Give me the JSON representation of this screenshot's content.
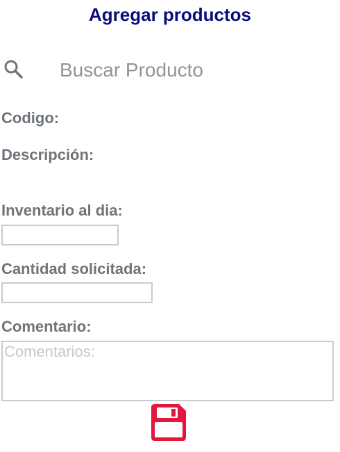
{
  "header": {
    "title": "Agregar productos"
  },
  "search": {
    "placeholder": "Buscar Producto",
    "value": "",
    "icon": "search-icon"
  },
  "form": {
    "codigo_label": "Codigo:",
    "descripcion_label": "Descripción:",
    "inventario_label": "Inventario al dia:",
    "inventario_value": "",
    "cantidad_label": "Cantidad solicitada:",
    "cantidad_value": "",
    "comentario_label": "Comentario:",
    "comentario_placeholder": "Comentarios:",
    "comentario_value": ""
  },
  "actions": {
    "save_icon": "floppy-disk-icon",
    "save_color": "#e4173f"
  },
  "colors": {
    "title": "#0b0b7e",
    "label": "#6e7479",
    "placeholder": "#8f9498",
    "border": "#c8cbcd"
  }
}
